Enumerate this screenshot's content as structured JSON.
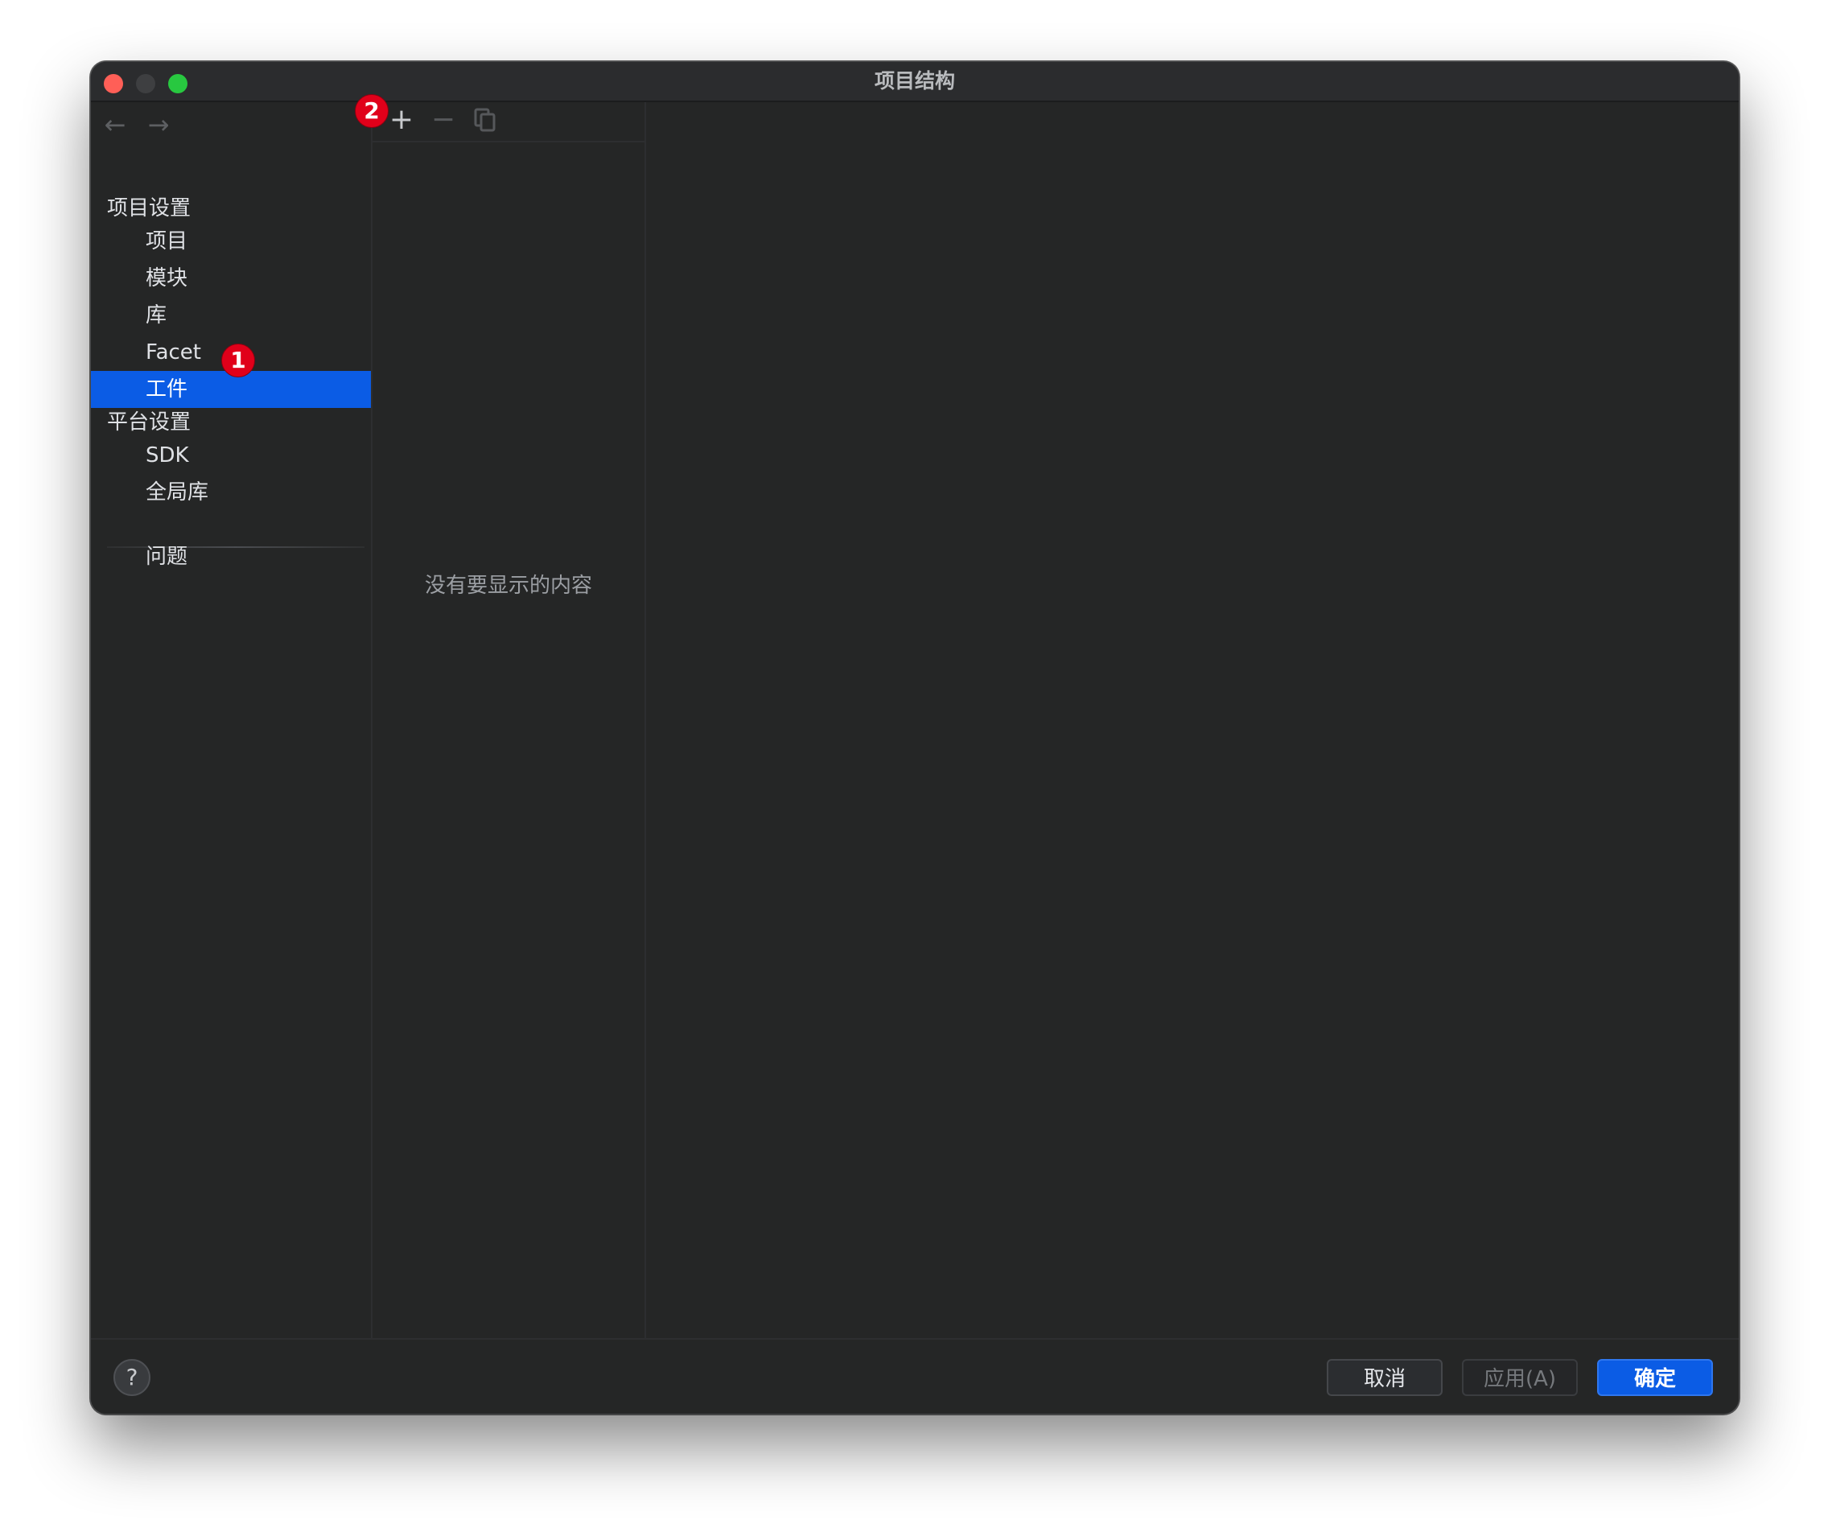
{
  "window": {
    "title": "项目结构"
  },
  "sidebar": {
    "sections": [
      {
        "header": "项目设置",
        "items": [
          {
            "label": "项目"
          },
          {
            "label": "模块"
          },
          {
            "label": "库"
          },
          {
            "label": "Facet"
          },
          {
            "label": "工件",
            "selected": true
          }
        ]
      },
      {
        "header": "平台设置",
        "items": [
          {
            "label": "SDK"
          },
          {
            "label": "全局库"
          }
        ]
      }
    ],
    "problems_label": "问题"
  },
  "middle": {
    "empty_text": "没有要显示的内容"
  },
  "annotations": {
    "badge1": "1",
    "badge2": "2"
  },
  "footer": {
    "help_label": "?",
    "cancel_label": "取消",
    "apply_label": "应用(A)",
    "ok_label": "确定"
  },
  "icons": {
    "back": "arrow-left-icon",
    "forward": "arrow-right-icon",
    "add": "plus-icon",
    "remove": "minus-icon",
    "copy": "copy-icon"
  },
  "colors": {
    "accent": "#0b5ce5",
    "window_bg": "#252626",
    "badge": "#e0001a",
    "close": "#ff5f57",
    "maximize": "#28c840"
  }
}
